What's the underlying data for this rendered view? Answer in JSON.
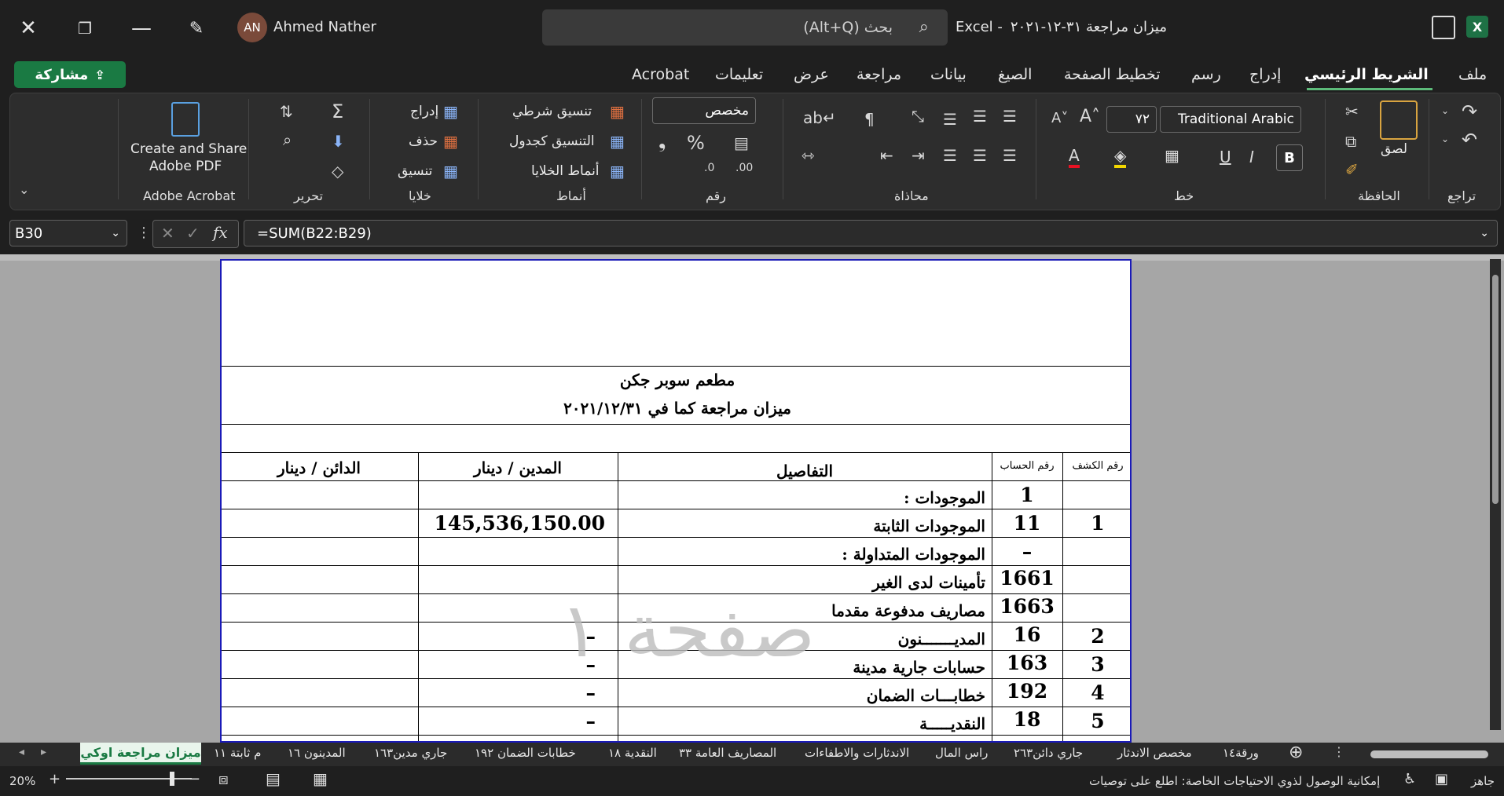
{
  "titlebar": {
    "user_initials": "AN",
    "user_name": "Ahmed Nather",
    "search_placeholder": "بحث (Alt+Q)",
    "doc_title": "ميزان مراجعة ٣١-١٢-٢٠٢١",
    "app_name": "Excel  -"
  },
  "menu": {
    "share": "مشاركة",
    "tabs": [
      "ملف",
      "الشريط الرئيسي",
      "إدراج",
      "رسم",
      "تخطيط الصفحة",
      "الصيغ",
      "بيانات",
      "مراجعة",
      "عرض",
      "تعليمات",
      "Acrobat"
    ]
  },
  "ribbon": {
    "undo_label": "تراجع",
    "clipboard_label": "الحافظة",
    "paste": "لصق",
    "font_label": "خط",
    "font_name": "Traditional Arabic",
    "font_size": "٧٢",
    "alignment_label": "محاذاة",
    "number_label": "رقم",
    "number_format": "مخصص",
    "styles_label": "أنماط",
    "cond_format": "تنسيق شرطي",
    "format_table": "التنسيق كجدول",
    "cell_styles": "أنماط الخلايا",
    "cells_label": "خلايا",
    "insert": "إدراج",
    "delete": "حذف",
    "format": "تنسيق",
    "editing_label": "تحرير",
    "acrobat_btn_1": "Create and Share",
    "acrobat_btn_2": "Adobe PDF",
    "acrobat_label": "Adobe Acrobat"
  },
  "formula_bar": {
    "name_box": "B30",
    "fx": "fx",
    "formula": "=SUM(B22:B29)"
  },
  "sheet": {
    "company": "مطعم سوبر جكن",
    "title": "ميزان مراجعة كما في ٢٠٢١/١٢/٣١",
    "headers": {
      "statement_no": "رقم الكشف",
      "account_no": "رقم الحساب",
      "details": "التفاصيل",
      "debit": "المدين / دينار",
      "credit": "الدائن / دينار"
    },
    "rows": [
      {
        "stmt": "",
        "acct": "1",
        "details": "الموجودات :",
        "debit": ""
      },
      {
        "stmt": "1",
        "acct": "11",
        "details": "الموجودات الثابتة",
        "debit": "145,536,150.00"
      },
      {
        "stmt": "",
        "acct": "–",
        "details": "الموجودات المتداولة  :",
        "debit": ""
      },
      {
        "stmt": "",
        "acct": "1661",
        "details": "تأمينات لدى الغير",
        "debit": ""
      },
      {
        "stmt": "",
        "acct": "1663",
        "details": "مصاريف مدفوعة مقدما",
        "debit": ""
      },
      {
        "stmt": "2",
        "acct": "16",
        "details": "المديـــــــنون",
        "debit": "–"
      },
      {
        "stmt": "3",
        "acct": "163",
        "details": "حسابات جارية مدينة",
        "debit": "–"
      },
      {
        "stmt": "4",
        "acct": "192",
        "details": "خطابـــات الضمان",
        "debit": "–"
      },
      {
        "stmt": "5",
        "acct": "18",
        "details": "النقديـــــة",
        "debit": "–"
      }
    ],
    "page_watermark": "صفحة ١"
  },
  "sheet_tabs": {
    "active": "ميزان مراجعة اوكي",
    "tabs": [
      "م ثابتة ١١",
      "المدينون ١٦",
      "جاري مدين١٦٣",
      "خطابات الضمان ١٩٢",
      "النقدية ١٨",
      "المصاريف العامة ٣٣",
      "الاندثارات والاطفاءات",
      "راس المال",
      "جاري دائن٢٦٣",
      "مخصص الاندثار",
      "ورقة١٤"
    ]
  },
  "statusbar": {
    "zoom": "20%",
    "ready": "جاهز",
    "accessibility": "إمكانية الوصول لذوي الاحتياجات الخاصة: اطلع على توصيات"
  }
}
